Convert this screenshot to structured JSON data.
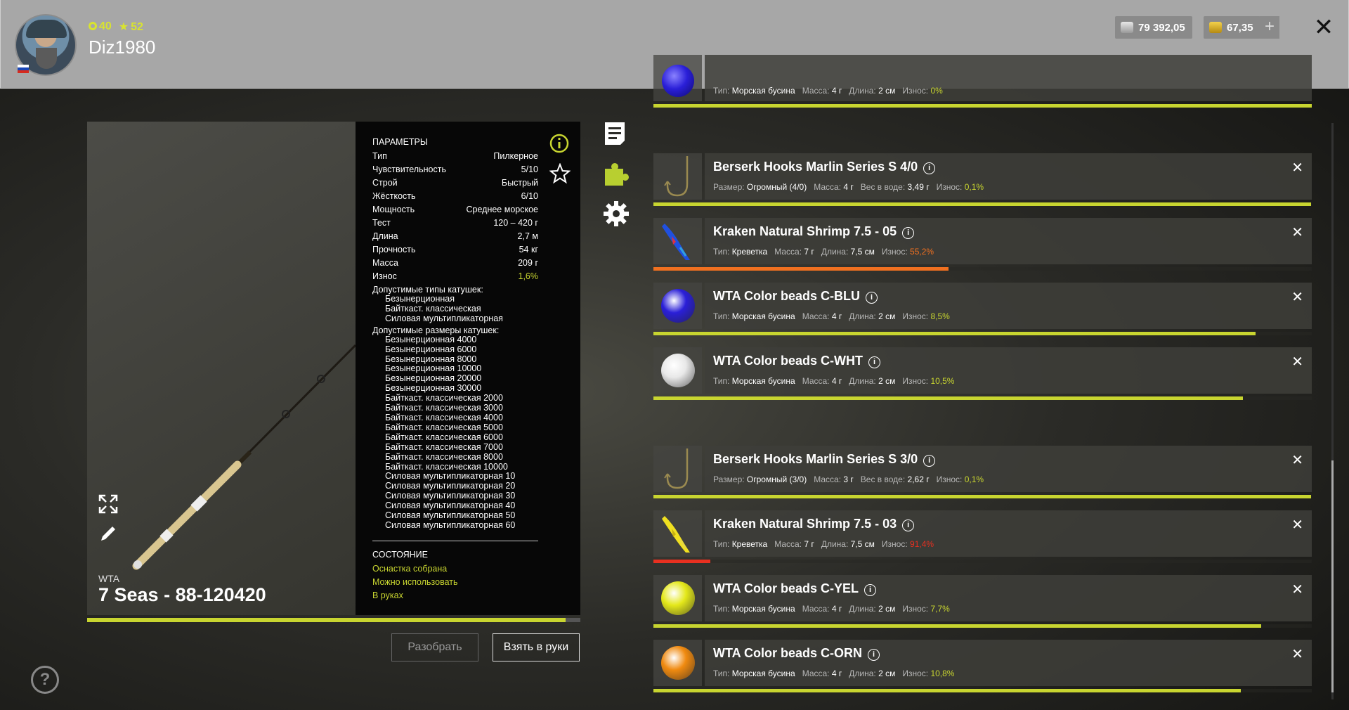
{
  "header": {
    "level": "40",
    "stars": "52",
    "username": "Diz1980",
    "silver": "79 392,05",
    "gold": "67,35",
    "plus": "+",
    "close": "✕"
  },
  "rod": {
    "brand": "WTA",
    "name": "7 Seas - 88-120420",
    "progress": 0.97
  },
  "params": {
    "title": "ПАРАМЕТРЫ",
    "rows": [
      {
        "label": "Тип",
        "value": "Пилкерное"
      },
      {
        "label": "Чувствительность",
        "value": "5/10"
      },
      {
        "label": "Строй",
        "value": "Быстрый"
      },
      {
        "label": "Жёсткость",
        "value": "6/10"
      },
      {
        "label": "Мощность",
        "value": "Среднее морское"
      },
      {
        "label": "Тест",
        "value": "120 – 420 г"
      },
      {
        "label": "Длина",
        "value": "2,7 м"
      },
      {
        "label": "Прочность",
        "value": "54 кг"
      },
      {
        "label": "Масса",
        "value": "209 г"
      },
      {
        "label": "Износ",
        "value": "1,6%"
      }
    ],
    "reel_types_label": "Допустимые типы катушек:",
    "reel_types": [
      "Безынерционная",
      "Байткаст. классическая",
      "Силовая мультипликаторная"
    ],
    "reel_sizes_label": "Допустимые размеры катушек:",
    "reel_sizes": [
      "Безынерционная 4000",
      "Безынерционная 6000",
      "Безынерционная 8000",
      "Безынерционная 10000",
      "Безынерционная 20000",
      "Безынерционная 30000",
      "Байткаст. классическая 2000",
      "Байткаст. классическая 3000",
      "Байткаст. классическая 4000",
      "Байткаст. классическая 5000",
      "Байткаст. классическая 6000",
      "Байткаст. классическая 7000",
      "Байткаст. классическая 8000",
      "Байткаст. классическая 10000",
      "Силовая мультипликаторная 10",
      "Силовая мультипликаторная 20",
      "Силовая мультипликаторная 30",
      "Силовая мультипликаторная 40",
      "Силовая мультипликаторная 50",
      "Силовая мультипликаторная 60"
    ],
    "state_title": "СОСТОЯНИЕ",
    "state_lines": [
      "Оснастка собрана",
      "Можно использовать",
      "В руках"
    ]
  },
  "buttons": {
    "disassemble": "Разобрать",
    "take": "Взять в руки"
  },
  "help": "?",
  "top_partial_item": {
    "desc_label1": "Тип:",
    "desc_value1": "Морская бусина",
    "desc_label2": "Масса:",
    "desc_value2": "4 г",
    "desc_label3": "Длина:",
    "desc_value3": "2 см",
    "desc_label4": "Износ:",
    "desc_value4": "0%"
  },
  "items": [
    {
      "name": "Berserk Hooks Marlin Series S 4/0",
      "l1": "Размер:",
      "v1": "Огромный (4/0)",
      "l2": "Масса:",
      "v2": "4 г",
      "l3": "Вес в воде:",
      "v3": "3,49 г",
      "l4": "Износ:",
      "v4": "0,1%",
      "wear": 0.999,
      "wear_color": "#c8d530",
      "kind": "hook"
    },
    {
      "name": "Kraken Natural Shrimp 7.5 - 05",
      "l1": "Тип:",
      "v1": "Креветка",
      "l2": "Масса:",
      "v2": "7 г",
      "l3": "Длина:",
      "v3": "7,5 см",
      "l4": "Износ:",
      "v4": "55,2%",
      "wear": 0.448,
      "wear_color": "#f07020",
      "kind": "shrimp-blue"
    },
    {
      "name": "WTA Color beads C-BLU",
      "l1": "Тип:",
      "v1": "Морская бусина",
      "l2": "Масса:",
      "v2": "4 г",
      "l3": "Длина:",
      "v3": "2 см",
      "l4": "Износ:",
      "v4": "8,5%",
      "wear": 0.915,
      "wear_color": "#c8d530",
      "kind": "bead",
      "bead_color": "#2a1fd8"
    },
    {
      "name": "WTA Color beads C-WHT",
      "l1": "Тип:",
      "v1": "Морская бусина",
      "l2": "Масса:",
      "v2": "4 г",
      "l3": "Длина:",
      "v3": "2 см",
      "l4": "Износ:",
      "v4": "10,5%",
      "wear": 0.895,
      "wear_color": "#c8d530",
      "kind": "bead",
      "bead_color": "#e8e8e8"
    },
    {
      "name": "Berserk Hooks Marlin Series S 3/0",
      "l1": "Размер:",
      "v1": "Огромный (3/0)",
      "l2": "Масса:",
      "v2": "3 г",
      "l3": "Вес в воде:",
      "v3": "2,62 г",
      "l4": "Износ:",
      "v4": "0,1%",
      "wear": 0.999,
      "wear_color": "#c8d530",
      "kind": "hook"
    },
    {
      "name": "Kraken Natural Shrimp 7.5 - 03",
      "l1": "Тип:",
      "v1": "Креветка",
      "l2": "Масса:",
      "v2": "7 г",
      "l3": "Длина:",
      "v3": "7,5 см",
      "l4": "Износ:",
      "v4": "91,4%",
      "wear": 0.086,
      "wear_color": "#e83020",
      "kind": "shrimp-yellow"
    },
    {
      "name": "WTA Color beads C-YEL",
      "l1": "Тип:",
      "v1": "Морская бусина",
      "l2": "Масса:",
      "v2": "4 г",
      "l3": "Длина:",
      "v3": "2 см",
      "l4": "Износ:",
      "v4": "7,7%",
      "wear": 0.923,
      "wear_color": "#c8d530",
      "kind": "bead",
      "bead_color": "#e4e81a"
    },
    {
      "name": "WTA Color beads C-ORN",
      "l1": "Тип:",
      "v1": "Морская бусина",
      "l2": "Масса:",
      "v2": "4 г",
      "l3": "Длина:",
      "v3": "2 см",
      "l4": "Износ:",
      "v4": "10,8%",
      "wear": 0.892,
      "wear_color": "#c8d530",
      "kind": "bead",
      "bead_color": "#f08a10"
    }
  ],
  "icons": {
    "notes": "notes-icon",
    "puzzle": "puzzle-icon",
    "gear": "gear-icon",
    "info": "info-icon",
    "star": "star-icon",
    "expand": "expand-icon",
    "pen": "pen-icon"
  },
  "colors": {
    "accent": "#c8d530",
    "warn": "#f07020",
    "danger": "#e83020"
  }
}
